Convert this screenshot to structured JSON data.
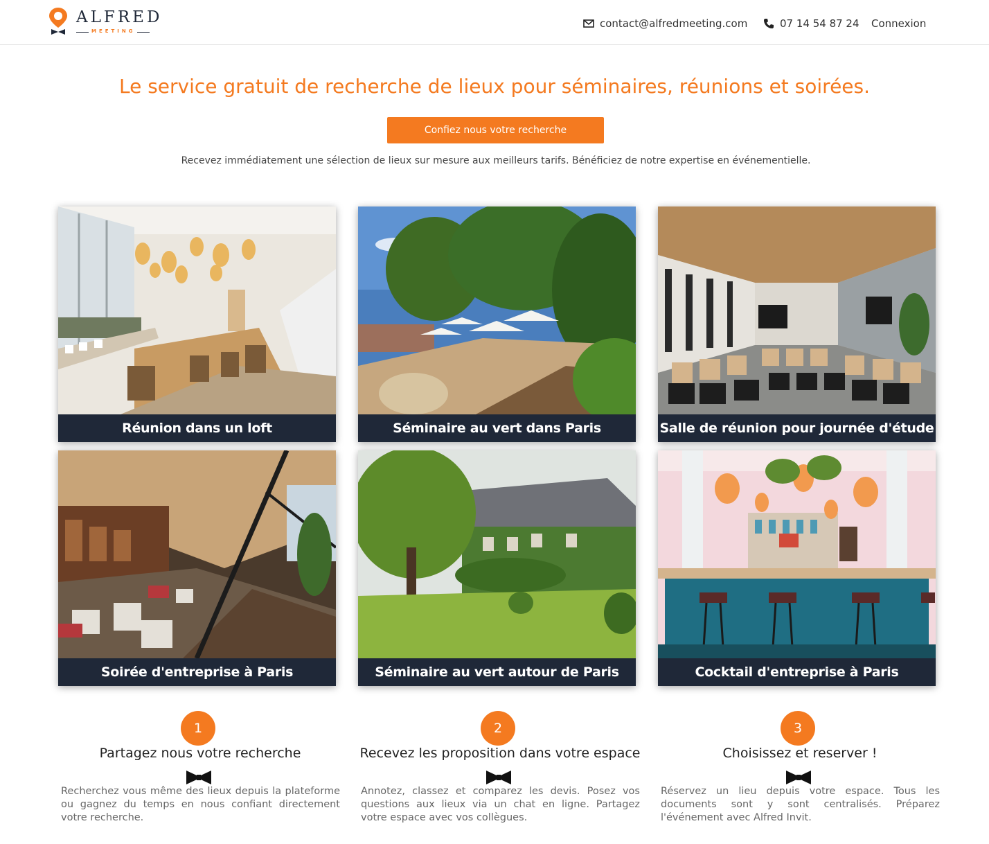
{
  "brand": {
    "name": "ALFRED",
    "sub": "MEETING",
    "orange": "#f47a20",
    "navy": "#1f2838"
  },
  "header": {
    "email_icon": "envelope-icon",
    "email": "contact@alfredmeeting.com",
    "phone_icon": "phone-icon",
    "phone": "07 14 54 87 24",
    "login": "Connexion"
  },
  "hero": {
    "title": "Le service gratuit de recherche de lieux pour séminaires, réunions et soirées.",
    "cta": "Confiez nous votre recherche",
    "subtitle": "Recevez immédiatement une sélection de lieux sur mesure aux meilleurs tarifs. Bénéficiez de notre expertise en événementielle."
  },
  "cards": [
    {
      "caption": "Réunion dans un loft"
    },
    {
      "caption": "Séminaire au vert dans Paris"
    },
    {
      "caption": "Salle de réunion pour journée d'étude"
    },
    {
      "caption": "Soirée d'entreprise à Paris"
    },
    {
      "caption": "Séminaire au vert autour de Paris"
    },
    {
      "caption": "Cocktail d'entreprise à Paris"
    }
  ],
  "steps": [
    {
      "number": "1",
      "title": "Partagez nous votre recherche",
      "icon": "bowtie-icon",
      "desc": "Recherchez vous même des lieux depuis la plateforme ou gagnez du temps en nous confiant directement votre recherche."
    },
    {
      "number": "2",
      "title": "Recevez les proposition dans votre espace",
      "icon": "bowtie-icon",
      "desc": "Annotez, classez et comparez les devis. Posez vos questions aux lieux via un chat en ligne. Partagez votre espace avec vos collègues."
    },
    {
      "number": "3",
      "title": "Choisissez et reserver !",
      "icon": "bowtie-icon",
      "desc": "Réservez un lieu depuis votre espace. Tous les documents sont y sont centralisés. Préparez l'événement avec Alfred Invit."
    }
  ]
}
